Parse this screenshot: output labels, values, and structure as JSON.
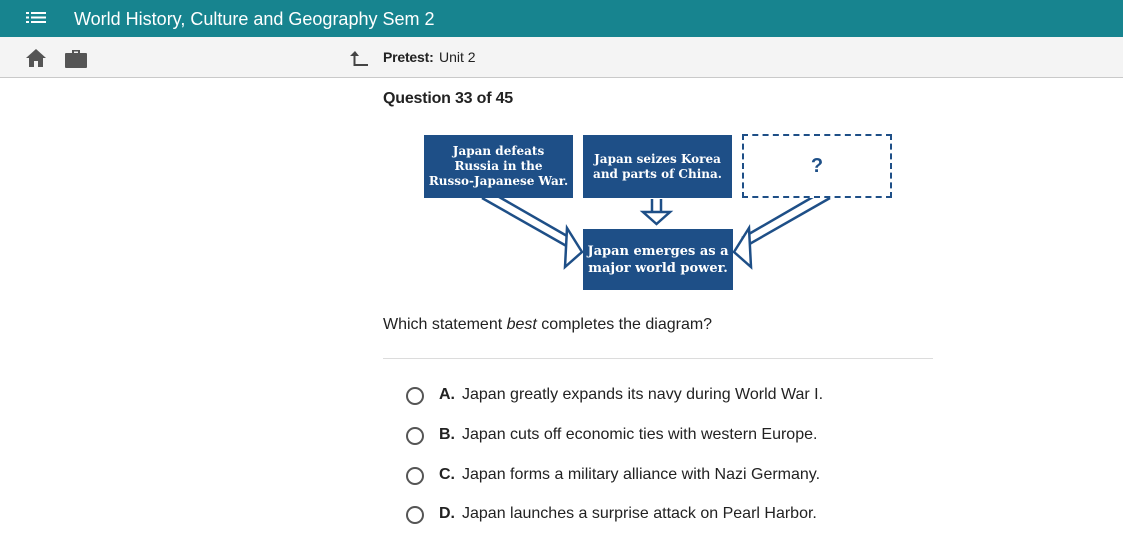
{
  "header": {
    "title": "World History, Culture and Geography Sem 2",
    "menu_icon": "list-menu-icon",
    "background_color": "#17848f"
  },
  "subheader": {
    "home_icon": "home-icon",
    "briefcase_icon": "briefcase-icon",
    "back_icon": "return-up-arrow-icon",
    "pretest_label": "Pretest:",
    "pretest_value": "Unit 2"
  },
  "question": {
    "title": "Question 33 of 45",
    "diagram": {
      "box1_lines": [
        "Japan defeats",
        "Russia in the",
        "Russo-Japanese War."
      ],
      "box2_lines": [
        "Japan seizes Korea",
        "and parts of China."
      ],
      "box3_text": "?",
      "center_lines": [
        "Japan emerges as a",
        "major world power."
      ],
      "box_color": "#1e4f87"
    },
    "prompt_before": "Which statement ",
    "prompt_emphasis": "best",
    "prompt_after": " completes the diagram?",
    "options": [
      {
        "letter": "A.",
        "text": "Japan greatly expands its navy during World War I."
      },
      {
        "letter": "B.",
        "text": "Japan cuts off economic ties with western Europe."
      },
      {
        "letter": "C.",
        "text": "Japan forms a military alliance with Nazi Germany."
      },
      {
        "letter": "D.",
        "text": "Japan launches a surprise attack on Pearl Harbor."
      }
    ]
  }
}
